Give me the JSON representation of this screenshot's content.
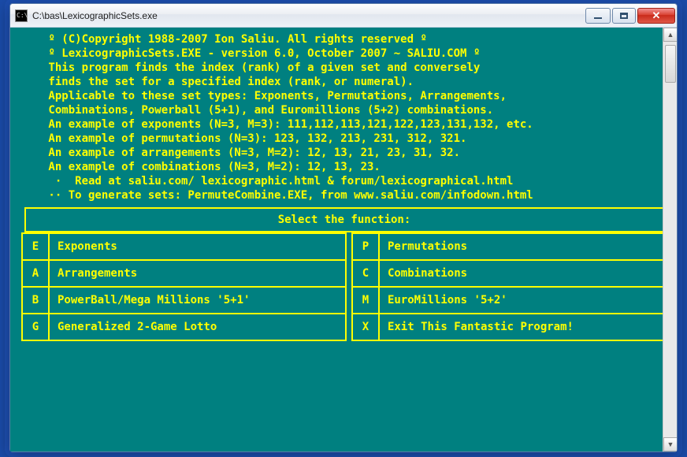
{
  "window": {
    "title": "C:\\bas\\LexicographicSets.exe"
  },
  "header_lines": [
    " º (C)Copyright 1988-2007 Ion Saliu. All rights reserved º",
    " º LexicographicSets.EXE - version 6.0, October 2007 ~ SALIU.COM º",
    "",
    " This program finds the index (rank) of a given set and conversely",
    " finds the set for a specified index (rank, or numeral).",
    " Applicable to these set types: Exponents, Permutations, Arrangements,",
    " Combinations, Powerball (5+1), and Euromillions (5+2) combinations.",
    " An example of exponents (N=3, M=3): 111,112,113,121,122,123,131,132, etc.",
    " An example of permutations (N=3): 123, 132, 213, 231, 312, 321.",
    " An example of arrangements (N=3, M=2): 12, 13, 21, 23, 31, 32.",
    " An example of combinations (N=3, M=2): 12, 13, 23.",
    "  ·  Read at saliu.com/ lexicographic.html & forum/lexicographical.html",
    " ·· To generate sets: PermuteCombine.EXE, from www.saliu.com/infodown.html"
  ],
  "menu": {
    "title": "Select the function:",
    "rows": [
      {
        "lk": "E",
        "ll": "Exponents",
        "rk": "P",
        "rl": "Permutations"
      },
      {
        "lk": "A",
        "ll": "Arrangements",
        "rk": "C",
        "rl": "Combinations"
      },
      {
        "lk": "B",
        "ll": "PowerBall/Mega Millions '5+1'",
        "rk": "M",
        "rl": "EuroMillions '5+2'"
      },
      {
        "lk": "G",
        "ll": "Generalized 2-Game Lotto",
        "rk": "X",
        "rl": "Exit This Fantastic Program!"
      }
    ]
  },
  "colors": {
    "console_bg": "#008080",
    "console_fg": "#ffff00"
  }
}
